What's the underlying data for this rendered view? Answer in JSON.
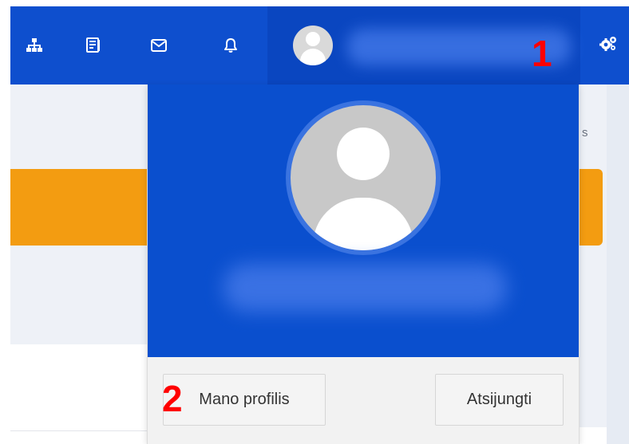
{
  "navbar": {
    "icons": [
      "sitemap-icon",
      "book-icon",
      "mail-icon",
      "bell-icon",
      "gears-icon"
    ],
    "user_menu": {
      "avatar": "user-avatar-icon"
    }
  },
  "page": {
    "stray_text": "s"
  },
  "dropdown": {
    "profile_button": "Mano profilis",
    "logout_button": "Atsijungti"
  },
  "annotations": {
    "marker_1": "1",
    "marker_2": "2"
  },
  "colors": {
    "navbar": "#0e4fce",
    "dropdown_header": "#0a4fce",
    "banner": "#f39c11",
    "marker": "#ff0000"
  }
}
